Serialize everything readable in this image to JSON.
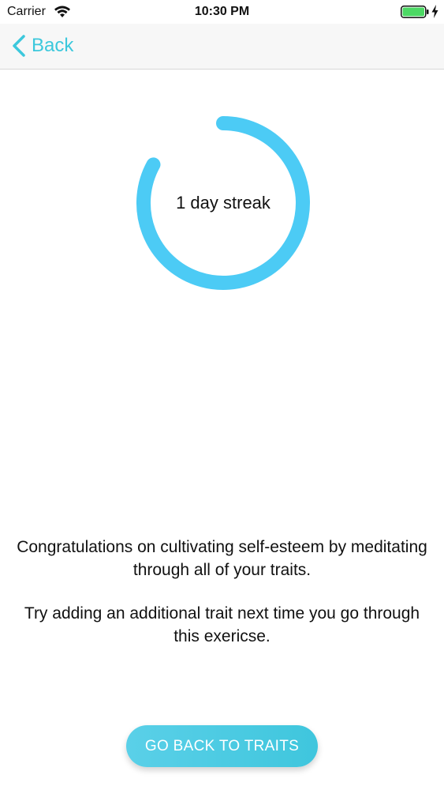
{
  "status_bar": {
    "carrier": "Carrier",
    "time": "10:30 PM",
    "battery_color": "#4cd964"
  },
  "nav": {
    "back_label": "Back",
    "accent_color": "#3cc8dc"
  },
  "streak": {
    "label": "1 day streak",
    "ring_progress": 0.83,
    "ring_color": "#4ccbf5"
  },
  "message": {
    "paragraph_1": "Congratulations on cultivating self-esteem by meditating through all of your traits.",
    "paragraph_2": "Try adding an additional trait next time you go through this exericse."
  },
  "actions": {
    "go_back_label": "GO BACK TO TRAITS"
  }
}
